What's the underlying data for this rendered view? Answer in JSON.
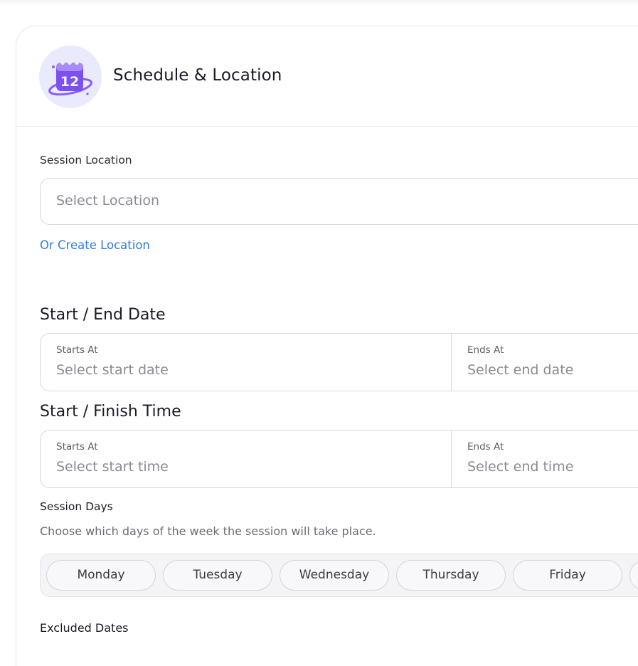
{
  "card": {
    "title": "Schedule & Location",
    "icon": "calendar-12-icon"
  },
  "location": {
    "label": "Session Location",
    "placeholder": "Select Location",
    "create_link": "Or Create Location"
  },
  "dates": {
    "heading": "Start / End Date",
    "start_label": "Starts At",
    "start_placeholder": "Select start date",
    "end_label": "Ends At",
    "end_placeholder": "Select end date"
  },
  "times": {
    "heading": "Start / Finish Time",
    "start_label": "Starts At",
    "start_placeholder": "Select start time",
    "end_label": "Ends At",
    "end_placeholder": "Select end time"
  },
  "session_days": {
    "title": "Session Days",
    "description": "Choose which days of the week the session will take place.",
    "days": [
      "Monday",
      "Tuesday",
      "Wednesday",
      "Thursday",
      "Friday",
      ""
    ]
  },
  "excluded_dates": {
    "title": "Excluded Dates"
  },
  "colors": {
    "accent_link": "#2f7be6",
    "icon_purple": "#7b4ef0",
    "avatar_bg": "#e9eafb"
  }
}
